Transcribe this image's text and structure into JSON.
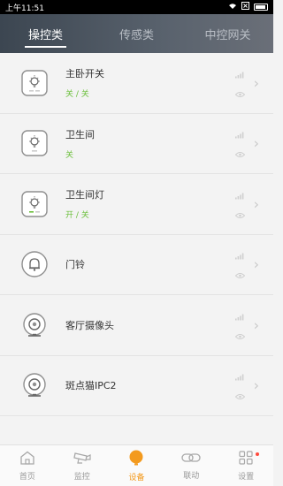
{
  "status_bar": {
    "time": "上午11:51"
  },
  "tabs": [
    {
      "label": "操控类",
      "active": true
    },
    {
      "label": "传感类",
      "active": false
    },
    {
      "label": "中控网关",
      "active": false
    }
  ],
  "devices": [
    {
      "name": "主卧开关",
      "state": "关 / 关",
      "icon": "light-switch-icon"
    },
    {
      "name": "卫生间",
      "state": "关",
      "icon": "light-switch-icon"
    },
    {
      "name": "卫生间灯",
      "state": "开 / 关",
      "icon": "light-switch-icon"
    },
    {
      "name": "门铃",
      "state": "",
      "icon": "doorbell-icon"
    },
    {
      "name": "客厅摄像头",
      "state": "",
      "icon": "camera-icon"
    },
    {
      "name": "斑点猫IPC2",
      "state": "",
      "icon": "camera-icon"
    }
  ],
  "bottom_nav": [
    {
      "label": "首页",
      "icon": "home-icon",
      "active": false
    },
    {
      "label": "监控",
      "icon": "cctv-icon",
      "active": false
    },
    {
      "label": "设备",
      "icon": "device-icon",
      "active": true
    },
    {
      "label": "联动",
      "icon": "link-icon",
      "active": false
    },
    {
      "label": "设置",
      "icon": "grid-settings-icon",
      "active": false,
      "badge": true
    }
  ],
  "colors": {
    "accent": "#f39a1e",
    "state_green": "#6bbf3b",
    "header_dark": "#3c4651"
  }
}
